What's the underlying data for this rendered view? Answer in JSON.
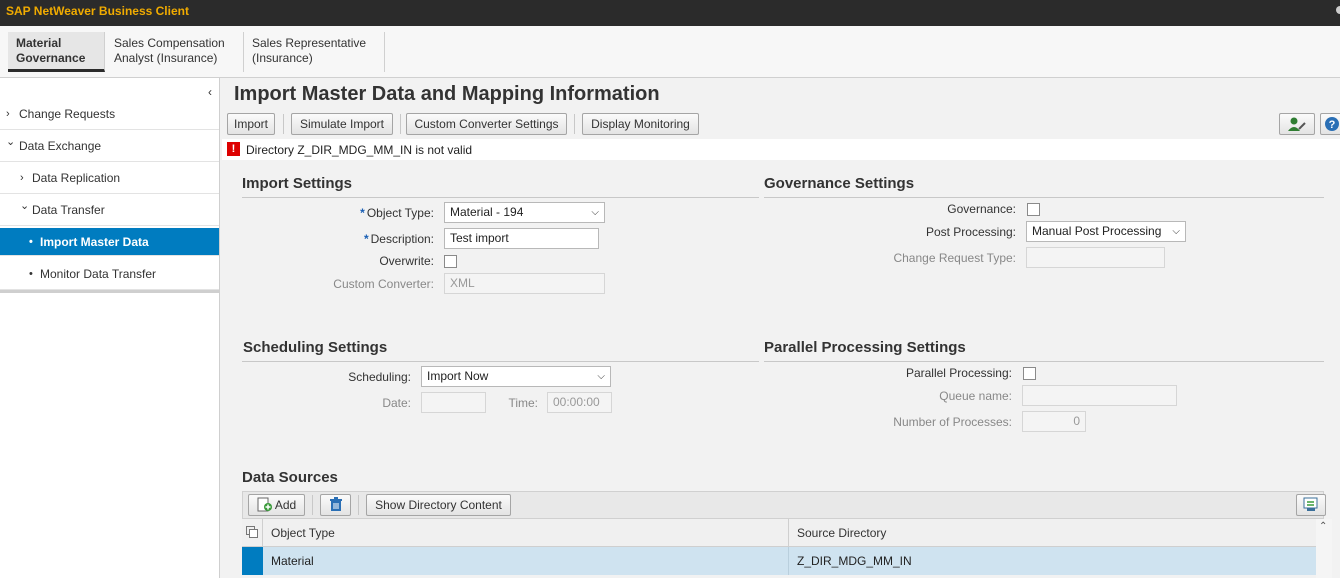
{
  "app": {
    "title": "SAP NetWeaver Business Client"
  },
  "roles": [
    {
      "label": "Material\nGovernance",
      "active": true
    },
    {
      "label": "Sales Compensation\nAnalyst (Insurance)",
      "active": false
    },
    {
      "label": "Sales Representative\n(Insurance)",
      "active": false
    }
  ],
  "nav": {
    "collapse_glyph": "‹",
    "items": [
      {
        "label": "Change Requests",
        "arrow": "›"
      },
      {
        "label": "Data Exchange",
        "arrow": "⌄"
      },
      {
        "label": "Data Replication",
        "arrow": "›"
      },
      {
        "label": "Data Transfer",
        "arrow": "⌄"
      },
      {
        "label": "Import Master Data",
        "arrow": "•"
      },
      {
        "label": "Monitor Data Transfer",
        "arrow": "•"
      }
    ]
  },
  "page": {
    "title": "Import Master Data and Mapping Information",
    "toolbar": {
      "import": "Import",
      "simulate": "Simulate Import",
      "converter": "Custom Converter Settings",
      "monitor": "Display Monitoring"
    },
    "message": {
      "icon": "error-icon",
      "text": "Directory Z_DIR_MDG_MM_IN is not valid"
    }
  },
  "import_settings": {
    "heading": "Import Settings",
    "object_type_label": "Object Type:",
    "object_type_value": "Material - 194",
    "description_label": "Description:",
    "description_value": "Test import",
    "overwrite_label": "Overwrite:",
    "converter_label": "Custom Converter:",
    "converter_value": "XML",
    "required_mark": "*"
  },
  "governance_settings": {
    "heading": "Governance Settings",
    "governance_label": "Governance:",
    "post_label": "Post Processing:",
    "post_value": "Manual Post Processing",
    "cr_type_label": "Change Request Type:"
  },
  "scheduling_settings": {
    "heading": "Scheduling Settings",
    "scheduling_label": "Scheduling:",
    "scheduling_value": "Import Now",
    "date_label": "Date:",
    "time_label": "Time:",
    "time_value": "00:00:00"
  },
  "parallel_settings": {
    "heading": "Parallel Processing Settings",
    "parallel_label": "Parallel Processing:",
    "queue_label": "Queue name:",
    "processes_label": "Number of Processes:",
    "processes_value": "0"
  },
  "data_sources": {
    "heading": "Data Sources",
    "add_label": "Add",
    "show_dir_label": "Show Directory Content",
    "columns": [
      "Object Type",
      "Source Directory"
    ],
    "rows": [
      {
        "object_type": "Material",
        "source_directory": "Z_DIR_MDG_MM_IN"
      }
    ]
  },
  "colors": {
    "accent": "#007cc0",
    "title_text": "#f0ab00",
    "titlebar_bg": "#2b2b2b",
    "error": "#dd0000"
  }
}
